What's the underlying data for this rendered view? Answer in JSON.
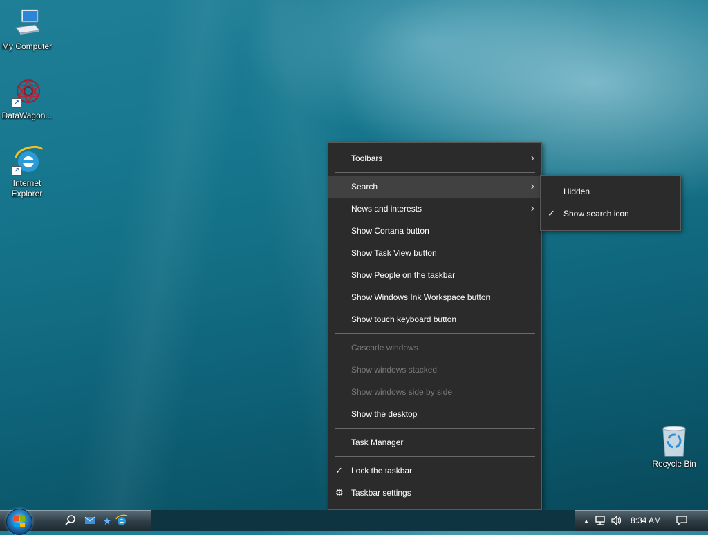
{
  "desktop": {
    "icons": [
      {
        "label": "My Computer"
      },
      {
        "label": "DataWagon..."
      },
      {
        "label": "Internet Explorer"
      },
      {
        "label": "Recycle Bin"
      }
    ]
  },
  "context_menu": {
    "items": [
      {
        "label": "Toolbars",
        "submenu": true
      },
      {
        "label": "Search",
        "submenu": true,
        "highlighted": true
      },
      {
        "label": "News and interests",
        "submenu": true
      },
      {
        "label": "Show Cortana button"
      },
      {
        "label": "Show Task View button"
      },
      {
        "label": "Show People on the taskbar"
      },
      {
        "label": "Show Windows Ink Workspace button"
      },
      {
        "label": "Show touch keyboard button"
      },
      {
        "label": "Cascade windows",
        "disabled": true
      },
      {
        "label": "Show windows stacked",
        "disabled": true
      },
      {
        "label": "Show windows side by side",
        "disabled": true
      },
      {
        "label": "Show the desktop"
      },
      {
        "label": "Task Manager"
      },
      {
        "label": "Lock the taskbar",
        "checked": true
      },
      {
        "label": "Taskbar settings",
        "icon": "gear-icon"
      }
    ]
  },
  "search_submenu": {
    "items": [
      {
        "label": "Hidden"
      },
      {
        "label": "Show search icon",
        "checked": true
      }
    ]
  },
  "taskbar": {
    "clock": "8:34 AM"
  },
  "colors": {
    "menu_bg": "#2b2b2b",
    "menu_highlight": "#414141",
    "menu_disabled_text": "#7a7a7a"
  }
}
